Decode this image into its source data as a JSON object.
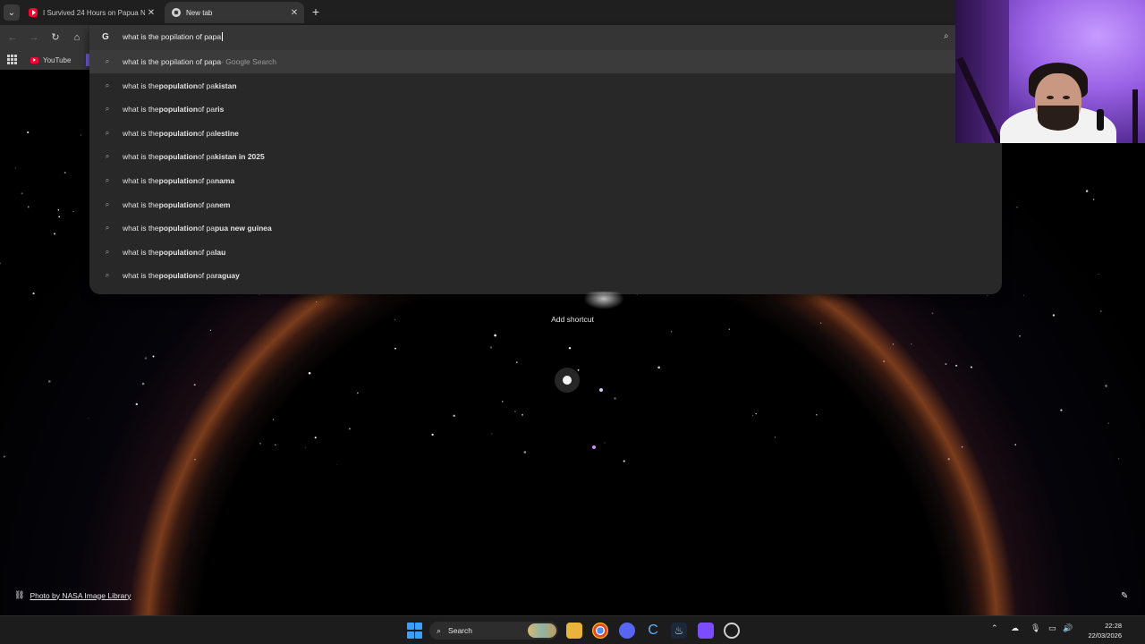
{
  "browser": {
    "tabs": [
      {
        "title": "I Survived 24 Hours on Papua N",
        "favicon": "youtube-icon",
        "active": false
      },
      {
        "title": "New tab",
        "favicon": "chrome-icon",
        "active": true
      }
    ],
    "bookmarks": [
      {
        "label": "YouTube",
        "favicon": "youtube-icon"
      }
    ],
    "omnibox": {
      "query": "what is the popilation of papa",
      "suggestions": [
        {
          "prefix": "what is the popilation of papa",
          "bold": "",
          "suffix": " - Google Search"
        },
        {
          "prefix": "what is the ",
          "bold": "population",
          "mid": " of pa",
          "bold2": "kistan"
        },
        {
          "prefix": "what is the ",
          "bold": "population",
          "mid": " of pa",
          "bold2": "ris"
        },
        {
          "prefix": "what is the ",
          "bold": "population",
          "mid": " of pa",
          "bold2": "lestine"
        },
        {
          "prefix": "what is the ",
          "bold": "population",
          "mid": " of pa",
          "bold2": "kistan in 2025"
        },
        {
          "prefix": "what is the ",
          "bold": "population",
          "mid": " of pa",
          "bold2": "nama"
        },
        {
          "prefix": "what is the ",
          "bold": "population",
          "mid": " of pa",
          "bold2": "nem"
        },
        {
          "prefix": "what is the ",
          "bold": "population",
          "mid": " of pa",
          "bold2": "pua new guinea"
        },
        {
          "prefix": "what is the ",
          "bold": "population",
          "mid": " of pa",
          "bold2": "lau"
        },
        {
          "prefix": "what is the ",
          "bold": "population",
          "mid": " of pa",
          "bold2": "raguay"
        }
      ]
    }
  },
  "page": {
    "add_shortcut": "Add shortcut",
    "credit": "Photo by NASA Image Library"
  },
  "taskbar": {
    "search_label": "Search",
    "time": "22:28",
    "date": "22/03/2026"
  },
  "colors": {
    "accent": "#3aa0ff",
    "youtube": "#ff0033",
    "omnibox_bg": "#282828"
  }
}
